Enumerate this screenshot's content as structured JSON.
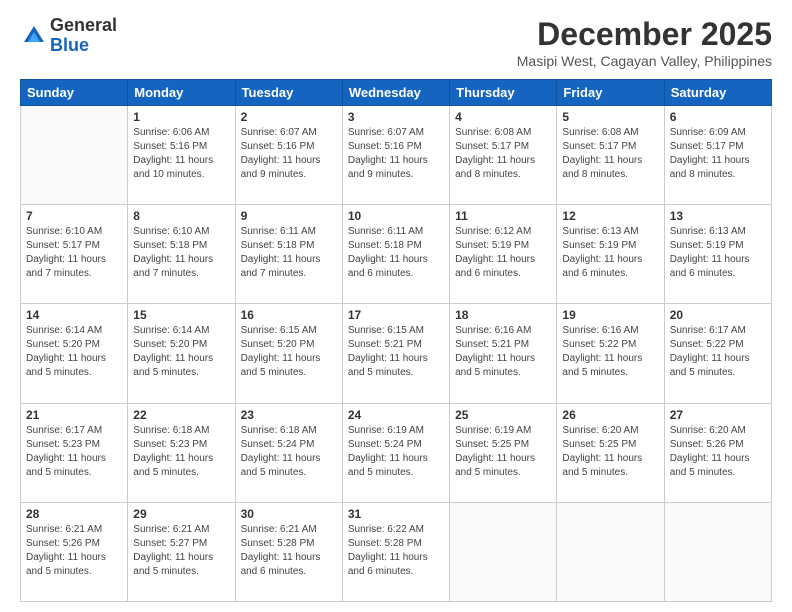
{
  "logo": {
    "general": "General",
    "blue": "Blue"
  },
  "title": "December 2025",
  "subtitle": "Masipi West, Cagayan Valley, Philippines",
  "headers": [
    "Sunday",
    "Monday",
    "Tuesday",
    "Wednesday",
    "Thursday",
    "Friday",
    "Saturday"
  ],
  "weeks": [
    [
      {
        "day": "",
        "sunrise": "",
        "sunset": "",
        "daylight": ""
      },
      {
        "day": "1",
        "sunrise": "Sunrise: 6:06 AM",
        "sunset": "Sunset: 5:16 PM",
        "daylight": "Daylight: 11 hours and 10 minutes."
      },
      {
        "day": "2",
        "sunrise": "Sunrise: 6:07 AM",
        "sunset": "Sunset: 5:16 PM",
        "daylight": "Daylight: 11 hours and 9 minutes."
      },
      {
        "day": "3",
        "sunrise": "Sunrise: 6:07 AM",
        "sunset": "Sunset: 5:16 PM",
        "daylight": "Daylight: 11 hours and 9 minutes."
      },
      {
        "day": "4",
        "sunrise": "Sunrise: 6:08 AM",
        "sunset": "Sunset: 5:17 PM",
        "daylight": "Daylight: 11 hours and 8 minutes."
      },
      {
        "day": "5",
        "sunrise": "Sunrise: 6:08 AM",
        "sunset": "Sunset: 5:17 PM",
        "daylight": "Daylight: 11 hours and 8 minutes."
      },
      {
        "day": "6",
        "sunrise": "Sunrise: 6:09 AM",
        "sunset": "Sunset: 5:17 PM",
        "daylight": "Daylight: 11 hours and 8 minutes."
      }
    ],
    [
      {
        "day": "7",
        "sunrise": "Sunrise: 6:10 AM",
        "sunset": "Sunset: 5:17 PM",
        "daylight": "Daylight: 11 hours and 7 minutes."
      },
      {
        "day": "8",
        "sunrise": "Sunrise: 6:10 AM",
        "sunset": "Sunset: 5:18 PM",
        "daylight": "Daylight: 11 hours and 7 minutes."
      },
      {
        "day": "9",
        "sunrise": "Sunrise: 6:11 AM",
        "sunset": "Sunset: 5:18 PM",
        "daylight": "Daylight: 11 hours and 7 minutes."
      },
      {
        "day": "10",
        "sunrise": "Sunrise: 6:11 AM",
        "sunset": "Sunset: 5:18 PM",
        "daylight": "Daylight: 11 hours and 6 minutes."
      },
      {
        "day": "11",
        "sunrise": "Sunrise: 6:12 AM",
        "sunset": "Sunset: 5:19 PM",
        "daylight": "Daylight: 11 hours and 6 minutes."
      },
      {
        "day": "12",
        "sunrise": "Sunrise: 6:13 AM",
        "sunset": "Sunset: 5:19 PM",
        "daylight": "Daylight: 11 hours and 6 minutes."
      },
      {
        "day": "13",
        "sunrise": "Sunrise: 6:13 AM",
        "sunset": "Sunset: 5:19 PM",
        "daylight": "Daylight: 11 hours and 6 minutes."
      }
    ],
    [
      {
        "day": "14",
        "sunrise": "Sunrise: 6:14 AM",
        "sunset": "Sunset: 5:20 PM",
        "daylight": "Daylight: 11 hours and 5 minutes."
      },
      {
        "day": "15",
        "sunrise": "Sunrise: 6:14 AM",
        "sunset": "Sunset: 5:20 PM",
        "daylight": "Daylight: 11 hours and 5 minutes."
      },
      {
        "day": "16",
        "sunrise": "Sunrise: 6:15 AM",
        "sunset": "Sunset: 5:20 PM",
        "daylight": "Daylight: 11 hours and 5 minutes."
      },
      {
        "day": "17",
        "sunrise": "Sunrise: 6:15 AM",
        "sunset": "Sunset: 5:21 PM",
        "daylight": "Daylight: 11 hours and 5 minutes."
      },
      {
        "day": "18",
        "sunrise": "Sunrise: 6:16 AM",
        "sunset": "Sunset: 5:21 PM",
        "daylight": "Daylight: 11 hours and 5 minutes."
      },
      {
        "day": "19",
        "sunrise": "Sunrise: 6:16 AM",
        "sunset": "Sunset: 5:22 PM",
        "daylight": "Daylight: 11 hours and 5 minutes."
      },
      {
        "day": "20",
        "sunrise": "Sunrise: 6:17 AM",
        "sunset": "Sunset: 5:22 PM",
        "daylight": "Daylight: 11 hours and 5 minutes."
      }
    ],
    [
      {
        "day": "21",
        "sunrise": "Sunrise: 6:17 AM",
        "sunset": "Sunset: 5:23 PM",
        "daylight": "Daylight: 11 hours and 5 minutes."
      },
      {
        "day": "22",
        "sunrise": "Sunrise: 6:18 AM",
        "sunset": "Sunset: 5:23 PM",
        "daylight": "Daylight: 11 hours and 5 minutes."
      },
      {
        "day": "23",
        "sunrise": "Sunrise: 6:18 AM",
        "sunset": "Sunset: 5:24 PM",
        "daylight": "Daylight: 11 hours and 5 minutes."
      },
      {
        "day": "24",
        "sunrise": "Sunrise: 6:19 AM",
        "sunset": "Sunset: 5:24 PM",
        "daylight": "Daylight: 11 hours and 5 minutes."
      },
      {
        "day": "25",
        "sunrise": "Sunrise: 6:19 AM",
        "sunset": "Sunset: 5:25 PM",
        "daylight": "Daylight: 11 hours and 5 minutes."
      },
      {
        "day": "26",
        "sunrise": "Sunrise: 6:20 AM",
        "sunset": "Sunset: 5:25 PM",
        "daylight": "Daylight: 11 hours and 5 minutes."
      },
      {
        "day": "27",
        "sunrise": "Sunrise: 6:20 AM",
        "sunset": "Sunset: 5:26 PM",
        "daylight": "Daylight: 11 hours and 5 minutes."
      }
    ],
    [
      {
        "day": "28",
        "sunrise": "Sunrise: 6:21 AM",
        "sunset": "Sunset: 5:26 PM",
        "daylight": "Daylight: 11 hours and 5 minutes."
      },
      {
        "day": "29",
        "sunrise": "Sunrise: 6:21 AM",
        "sunset": "Sunset: 5:27 PM",
        "daylight": "Daylight: 11 hours and 5 minutes."
      },
      {
        "day": "30",
        "sunrise": "Sunrise: 6:21 AM",
        "sunset": "Sunset: 5:28 PM",
        "daylight": "Daylight: 11 hours and 6 minutes."
      },
      {
        "day": "31",
        "sunrise": "Sunrise: 6:22 AM",
        "sunset": "Sunset: 5:28 PM",
        "daylight": "Daylight: 11 hours and 6 minutes."
      },
      {
        "day": "",
        "sunrise": "",
        "sunset": "",
        "daylight": ""
      },
      {
        "day": "",
        "sunrise": "",
        "sunset": "",
        "daylight": ""
      },
      {
        "day": "",
        "sunrise": "",
        "sunset": "",
        "daylight": ""
      }
    ]
  ]
}
